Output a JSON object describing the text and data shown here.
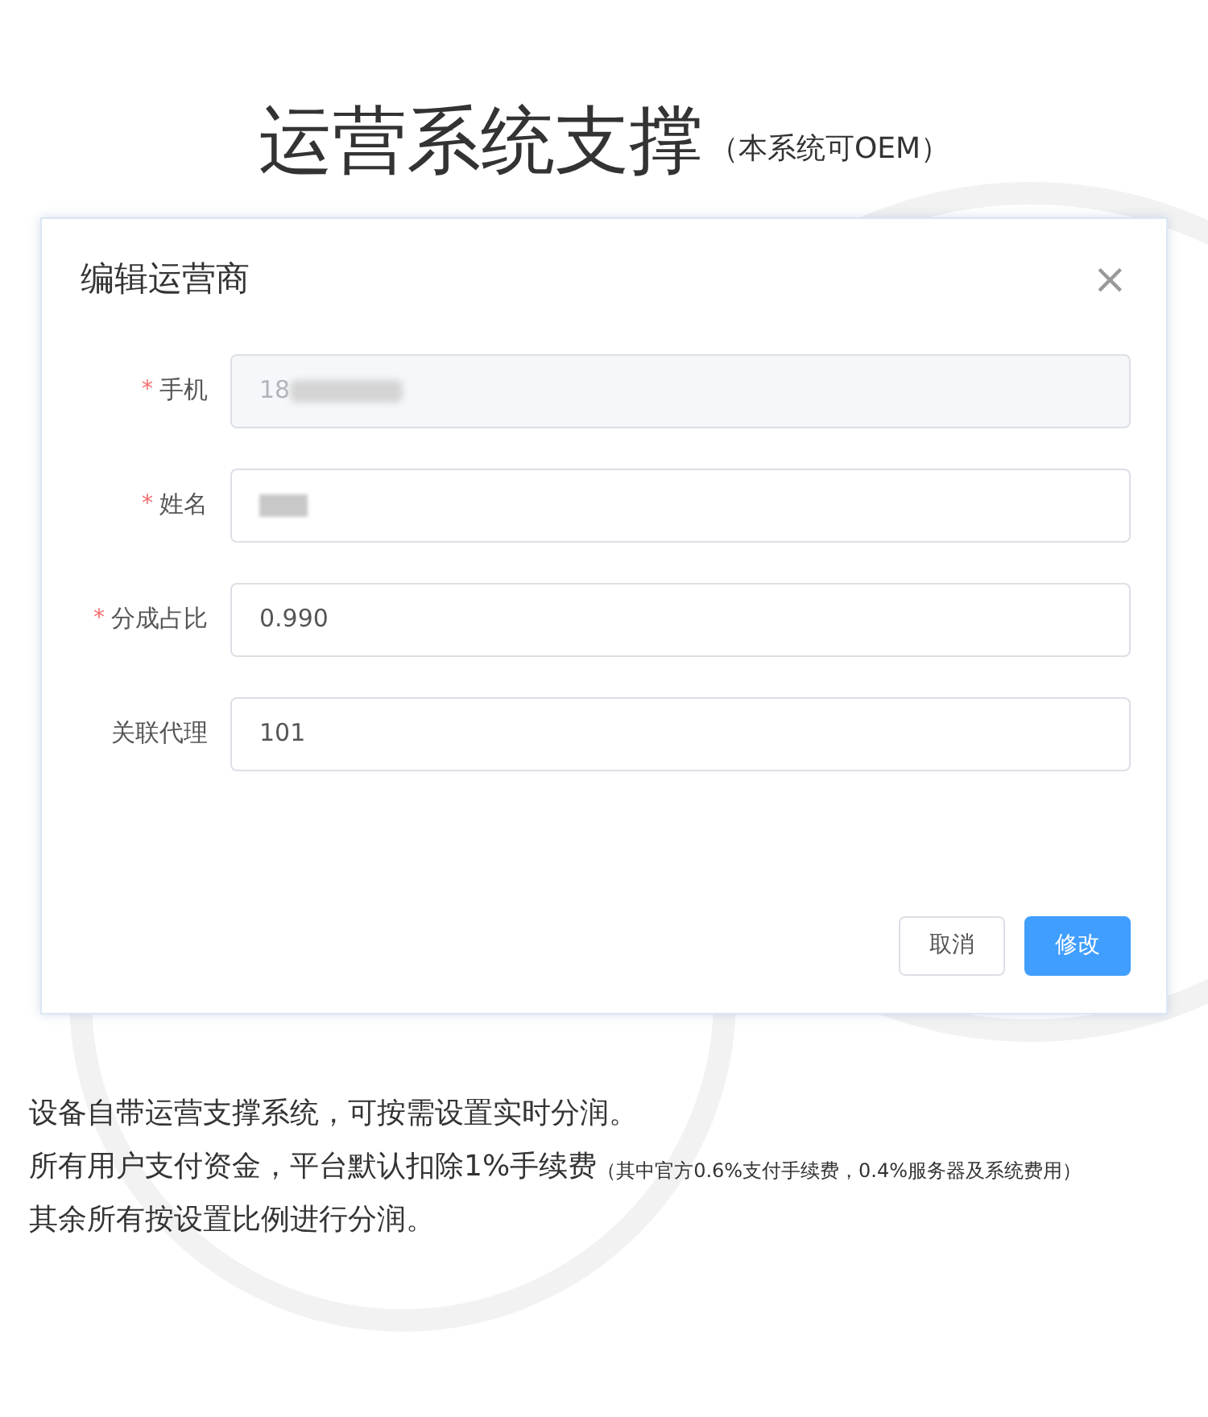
{
  "heading": {
    "title": "运营系统支撑",
    "note": "（本系统可OEM）"
  },
  "dialog": {
    "title": "编辑运营商",
    "close": "×",
    "required_mark": "*",
    "fields": [
      {
        "label": "手机",
        "required": true,
        "disabled": true,
        "value": "18",
        "redacted": true
      },
      {
        "label": "姓名",
        "required": true,
        "disabled": false,
        "redacted": true
      },
      {
        "label": "分成占比",
        "required": true,
        "disabled": false,
        "value": "0.990",
        "redacted": false
      },
      {
        "label": "关联代理",
        "required": false,
        "disabled": false,
        "value": "101",
        "redacted": false
      }
    ],
    "buttons": [
      {
        "label": "取消",
        "kind": "default"
      },
      {
        "label": "修改",
        "kind": "primary"
      }
    ]
  },
  "description": [
    {
      "text": "设备自带运营支撑系统，可按需设置实时分润。"
    },
    {
      "text": "所有用户支付资金，平台默认扣除1%手续费",
      "note": "（其中官方0.6%支付手续费，0.4%服务器及系统费用）"
    },
    {
      "text": "其余所有按设置比例进行分润。"
    }
  ]
}
